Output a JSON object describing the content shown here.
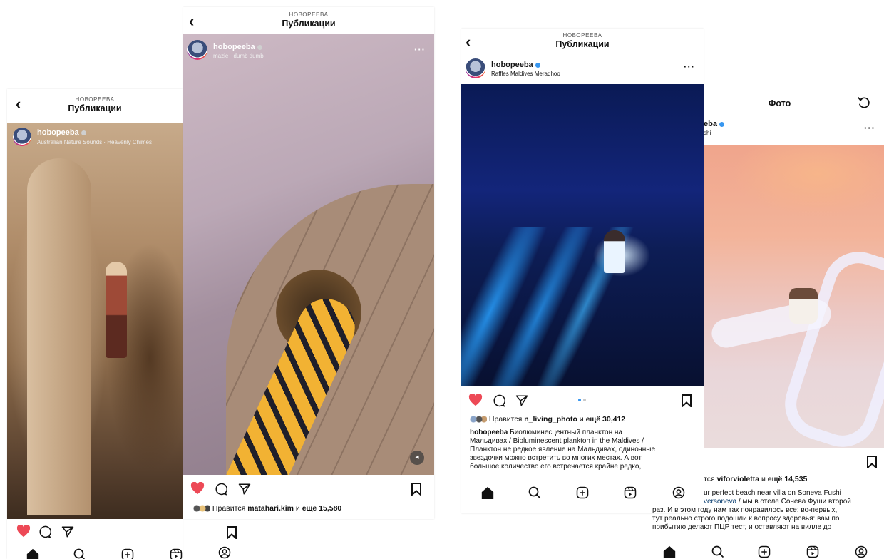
{
  "screen1": {
    "header_sub": "НОВОРЕЕВА",
    "header_title": "Публикации",
    "username": "hobopeeba",
    "subtitle": "Australian Nature Sounds · Heavenly Chimes"
  },
  "screen2": {
    "header_sub": "НОВОРЕЕВА",
    "header_title": "Публикации",
    "username": "hobopeeba",
    "subtitle": "mazie · dumb dumb",
    "more": "···",
    "likes_prefix": "Нравится",
    "likes_user": "matahari.kim",
    "likes_mid": "и",
    "likes_count": "ещё 15,580"
  },
  "screen3": {
    "header_sub": "НОВОРЕЕВА",
    "header_title": "Публикации",
    "username": "hobopeeba",
    "subtitle": "Raffles Maldives Meradhoo",
    "more": "···",
    "likes_prefix": "Нравится",
    "likes_user": "n_living_photo",
    "likes_mid": "и",
    "likes_count": "ещё 30,412",
    "caption_user": "hobopeeba",
    "caption_lines": [
      "Биолюминесцентный планктон на",
      "Мальдивах / Bioluminescent plankton in the Maldives /",
      "Планктон не редкое явление на Мальдивах, одиночные",
      "звездочки можно встретить во многих местах. А вот",
      "большое количество его встречается крайне редко,"
    ]
  },
  "screen4": {
    "header_title": "Фото",
    "username_partial": "eba",
    "subtitle_partial": "shi",
    "more": "···",
    "likes_prefix": "тся",
    "likes_user": "viforvioletta",
    "likes_mid": "и",
    "likes_count": "ещё 14,535",
    "caption_lines": [
      "ur perfect beach near villa on Soneva Fushi",
      "/ мы в отеле Сонева Фуши второй",
      "раз. И в этом году нам так понравилось все: во-первых,",
      "тут реально строго подошли к вопросу здоровья: вам по",
      "прибытию делают ПЦР тест, и оставляют на вилле до"
    ],
    "caption_link": "versoneva"
  },
  "colors": {
    "like_red": "#ed4956",
    "verified_blue": "#3897f0",
    "text": "#111111"
  },
  "icons": [
    "back-icon",
    "heart-icon",
    "comment-icon",
    "share-icon",
    "bookmark-icon",
    "home-icon",
    "search-icon",
    "add-icon",
    "reels-icon",
    "profile-icon",
    "refresh-icon",
    "sound-icon",
    "more-icon"
  ]
}
